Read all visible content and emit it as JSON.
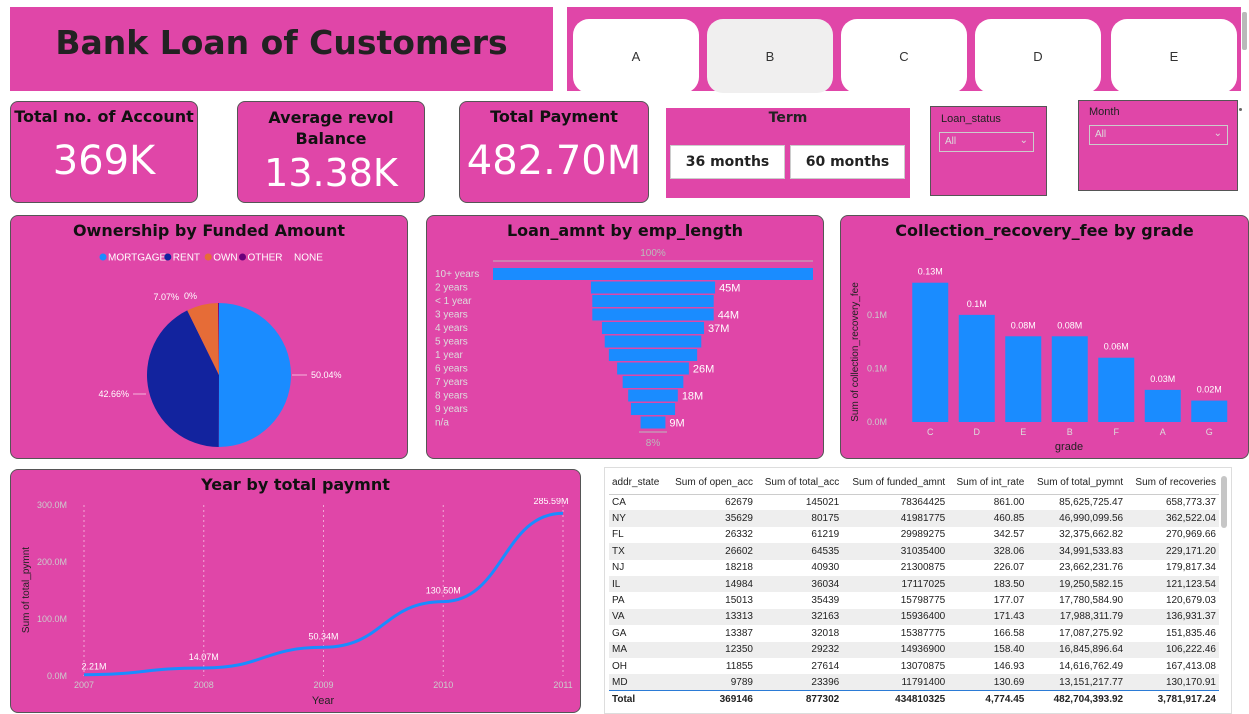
{
  "header": {
    "title": "Bank Loan of Customers"
  },
  "nav": {
    "buttons": [
      "A",
      "B",
      "C",
      "D",
      "E"
    ],
    "selected": "B"
  },
  "kpis": [
    {
      "label": "Total no. of Account",
      "value": "369K"
    },
    {
      "label": "Average revol Balance",
      "value": "13.38K"
    },
    {
      "label": "Total Payment",
      "value": "482.70M"
    }
  ],
  "term_slicer": {
    "title": "Term",
    "options": [
      "36 months",
      "60 months"
    ]
  },
  "loan_status_slicer": {
    "label": "Loan_status",
    "value": "All"
  },
  "month_slicer": {
    "label": "Month",
    "value": "All"
  },
  "colors": {
    "panel": "#e046a8",
    "bar": "#1a8cff",
    "rent": "#12239e",
    "own": "#e66c37",
    "other": "#6b007b"
  },
  "pie_chart": {
    "title": "Ownership by Funded Amount",
    "legend": [
      {
        "name": "MORTGAGE",
        "color": "#1a8cff"
      },
      {
        "name": "RENT",
        "color": "#12239e"
      },
      {
        "name": "OWN",
        "color": "#e66c37"
      },
      {
        "name": "OTHER",
        "color": "#6b007b"
      },
      {
        "name": "NONE",
        "color": "#e046a8"
      }
    ],
    "labels": {
      "mortgage": "50.04%",
      "rent": "42.66%",
      "own": "7.07%",
      "none": "0%"
    }
  },
  "funnel_chart": {
    "title": "Loan_amnt by emp_length",
    "top_label": "100%",
    "bottom_label": "8%",
    "categories": [
      "10+ years",
      "2 years",
      "< 1 year",
      "3 years",
      "4 years",
      "5 years",
      "1 year",
      "6 years",
      "7 years",
      "8 years",
      "9 years",
      "n/a"
    ],
    "bar_labels": [
      "45M",
      "44M",
      "37M",
      "26M",
      "18M",
      "9M"
    ]
  },
  "bar_chart": {
    "title": "Collection_recovery_fee by grade",
    "ylabel": "Sum of collection_recovery_fee",
    "xlabel": "grade",
    "ytick_labels": [
      "0.0M",
      "0.1M",
      "0.1M"
    ],
    "data_labels": [
      "0.13M",
      "0.1M",
      "0.08M",
      "0.08M",
      "0.06M",
      "0.03M",
      "0.02M"
    ]
  },
  "line_chart": {
    "title": "Year by total paymnt",
    "ylabel": "Sum of total_pymnt",
    "xlabel": "Year",
    "ytick_labels": [
      "0.0M",
      "100.0M",
      "200.0M",
      "300.0M"
    ],
    "data_labels": [
      "2.21M",
      "14.07M",
      "50.34M",
      "130.50M",
      "285.59M"
    ]
  },
  "chart_data": [
    {
      "type": "pie",
      "title": "Ownership by Funded Amount",
      "categories": [
        "MORTGAGE",
        "RENT",
        "OWN",
        "OTHER",
        "NONE"
      ],
      "values": [
        50.04,
        42.66,
        7.07,
        0.2,
        0
      ]
    },
    {
      "type": "bar",
      "title": "Loan_amnt by emp_length",
      "categories": [
        "10+ years",
        "2 years",
        "< 1 year",
        "3 years",
        "4 years",
        "5 years",
        "1 year",
        "6 years",
        "7 years",
        "8 years",
        "9 years",
        "n/a"
      ],
      "values": [
        116,
        45,
        44,
        44,
        37,
        35,
        32,
        26,
        22,
        18,
        16,
        9
      ]
    },
    {
      "type": "bar",
      "title": "Collection_recovery_fee by grade",
      "xlabel": "grade",
      "ylabel": "Sum of collection_recovery_fee",
      "categories": [
        "C",
        "D",
        "E",
        "B",
        "F",
        "A",
        "G"
      ],
      "values": [
        0.13,
        0.1,
        0.08,
        0.08,
        0.06,
        0.03,
        0.02
      ],
      "ylim": [
        0,
        0.14
      ]
    },
    {
      "type": "line",
      "title": "Year by total paymnt",
      "xlabel": "Year",
      "ylabel": "Sum of total_pymnt",
      "x": [
        2007,
        2008,
        2009,
        2010,
        2011
      ],
      "values": [
        2.21,
        14.07,
        50.34,
        130.5,
        285.59
      ],
      "ylim": [
        0,
        300
      ]
    }
  ],
  "table": {
    "columns": [
      "addr_state",
      "Sum of open_acc",
      "Sum of total_acc",
      "Sum of funded_amnt",
      "Sum of int_rate",
      "Sum of total_pymnt",
      "Sum of recoveries"
    ],
    "rows": [
      [
        "CA",
        "62679",
        "145021",
        "78364425",
        "861.00",
        "85,625,725.47",
        "658,773.37"
      ],
      [
        "NY",
        "35629",
        "80175",
        "41981775",
        "460.85",
        "46,990,099.56",
        "362,522.04"
      ],
      [
        "FL",
        "26332",
        "61219",
        "29989275",
        "342.57",
        "32,375,662.82",
        "270,969.66"
      ],
      [
        "TX",
        "26602",
        "64535",
        "31035400",
        "328.06",
        "34,991,533.83",
        "229,171.20"
      ],
      [
        "NJ",
        "18218",
        "40930",
        "21300875",
        "226.07",
        "23,662,231.76",
        "179,817.34"
      ],
      [
        "IL",
        "14984",
        "36034",
        "17117025",
        "183.50",
        "19,250,582.15",
        "121,123.54"
      ],
      [
        "PA",
        "15013",
        "35439",
        "15798775",
        "177.07",
        "17,780,584.90",
        "120,679.03"
      ],
      [
        "VA",
        "13313",
        "32163",
        "15936400",
        "171.43",
        "17,988,311.79",
        "136,931.37"
      ],
      [
        "GA",
        "13387",
        "32018",
        "15387775",
        "166.58",
        "17,087,275.92",
        "151,835.46"
      ],
      [
        "MA",
        "12350",
        "29232",
        "14936900",
        "158.40",
        "16,845,896.64",
        "106,222.46"
      ],
      [
        "OH",
        "11855",
        "27614",
        "13070875",
        "146.93",
        "14,616,762.49",
        "167,413.08"
      ],
      [
        "MD",
        "9789",
        "23396",
        "11791400",
        "130.69",
        "13,151,217.77",
        "130,170.91"
      ]
    ],
    "total": [
      "Total",
      "369146",
      "877302",
      "434810325",
      "4,774.45",
      "482,704,393.92",
      "3,781,917.24"
    ]
  }
}
